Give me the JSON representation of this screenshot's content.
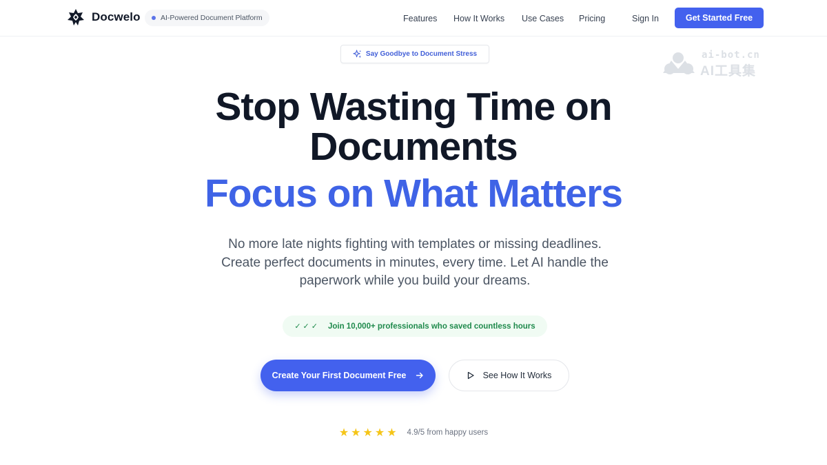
{
  "header": {
    "brand": "Docwelo",
    "badge": "AI-Powered Document Platform",
    "nav": [
      "Features",
      "How It Works",
      "Use Cases",
      "Pricing"
    ],
    "sign_in": "Sign In",
    "cta": "Get Started Free"
  },
  "hero": {
    "tag": "Say Goodbye to Document Stress",
    "title_line1": "Stop Wasting Time on",
    "title_line2": "Documents",
    "title_accent": "Focus on What Matters",
    "subtitle_lines": [
      "No more late nights fighting with templates or missing deadlines.",
      "Create perfect documents in minutes, every time. Let AI handle the",
      "paperwork while you build your dreams."
    ],
    "proof_checks": "✓✓✓",
    "proof_text": "Join 10,000+ professionals who saved countless hours",
    "primary_cta": "Create Your First Document Free",
    "secondary_cta": "See How It Works",
    "stars": "★★★★★",
    "rating_text": "4.9/5 from happy users"
  },
  "watermark": {
    "url": "ai-bot.cn",
    "name": "AI工具集"
  },
  "icons": {
    "logo": "star-logo-icon",
    "sparkle": "sparkle-icon",
    "arrow": "arrow-right-icon",
    "play": "play-icon",
    "star": "star-icon"
  },
  "colors": {
    "accent": "#4361ee",
    "accent_text": "#3f63e6",
    "badge_dot": "#5b73e8",
    "tag_text": "#4360d8",
    "proof_text": "#1f8a4c",
    "stars": "#f5c518"
  }
}
